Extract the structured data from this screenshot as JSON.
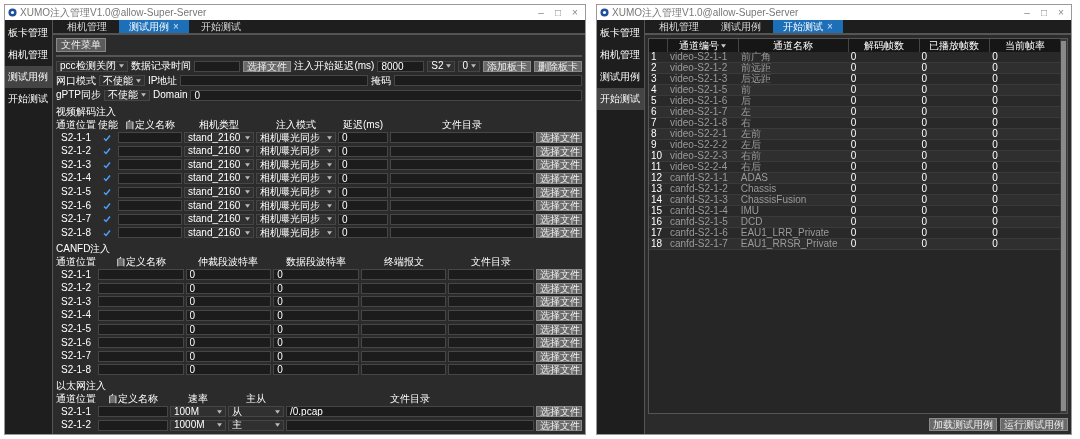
{
  "windows": [
    {
      "kind": "editor",
      "title": "XUMO注入管理V1.0@allow-Super-Server",
      "controls": [
        "–",
        "□",
        "×"
      ],
      "sidebar": [
        {
          "label": "板卡管理",
          "selected": false
        },
        {
          "label": "相机管理",
          "selected": false
        },
        {
          "label": "测试用例",
          "selected": true
        },
        {
          "label": "开始测试",
          "selected": false
        }
      ],
      "tabs": [
        {
          "label": "相机管理",
          "selected": false
        },
        {
          "label": "测试用例",
          "selected": true
        },
        {
          "label": "开始测试",
          "selected": false
        }
      ],
      "tab_close": "×",
      "toolbar_button": "文件菜单",
      "settings": [
        [
          {
            "kind": "select",
            "value": "pcc检测关闭"
          },
          {
            "kind": "label",
            "text": "数据记录时间"
          },
          {
            "kind": "input"
          },
          {
            "kind": "button",
            "label": "选择文件"
          },
          {
            "kind": "label",
            "text": "注入开始延迟(ms)"
          },
          {
            "kind": "input",
            "value": "8000"
          },
          {
            "kind": "select",
            "value": "S2"
          },
          {
            "kind": "select",
            "value": "0"
          },
          {
            "kind": "button",
            "label": "添加板卡"
          },
          {
            "kind": "button",
            "label": "删除板卡"
          }
        ],
        [
          {
            "kind": "label",
            "text": "网口模式"
          },
          {
            "kind": "select",
            "value": "不使能"
          },
          {
            "kind": "label",
            "text": "IP地址"
          },
          {
            "kind": "input"
          },
          {
            "kind": "label",
            "text": "掩码"
          },
          {
            "kind": "input"
          }
        ],
        [
          {
            "kind": "label",
            "text": "gPTP同步"
          },
          {
            "kind": "select",
            "value": "不使能"
          },
          {
            "kind": "label",
            "text": "Domain"
          },
          {
            "kind": "input",
            "value": "0"
          }
        ]
      ],
      "sections": [
        {
          "kind": "video",
          "title": "视频解码注入",
          "columns": [
            "通道位置",
            "使能",
            "自定义名称",
            "相机类型",
            "注入模式",
            "延迟(ms)",
            "文件目录"
          ],
          "rows": [
            [
              {
                "kind": "text",
                "text": "S2-1-1"
              },
              {
                "kind": "check",
                "checked": true
              },
              {
                "kind": "input"
              },
              {
                "kind": "select",
                "value": "stand_2160"
              },
              {
                "kind": "select",
                "value": "相机曝光同步"
              },
              {
                "kind": "input",
                "value": "0"
              },
              {
                "kind": "input"
              },
              {
                "kind": "button",
                "label": "选择文件"
              }
            ],
            [
              {
                "kind": "text",
                "text": "S2-1-2"
              },
              {
                "kind": "check",
                "checked": true
              },
              {
                "kind": "input"
              },
              {
                "kind": "select",
                "value": "stand_2160"
              },
              {
                "kind": "select",
                "value": "相机曝光同步"
              },
              {
                "kind": "input",
                "value": "0"
              },
              {
                "kind": "input"
              },
              {
                "kind": "button",
                "label": "选择文件"
              }
            ],
            [
              {
                "kind": "text",
                "text": "S2-1-3"
              },
              {
                "kind": "check",
                "checked": true
              },
              {
                "kind": "input"
              },
              {
                "kind": "select",
                "value": "stand_2160"
              },
              {
                "kind": "select",
                "value": "相机曝光同步"
              },
              {
                "kind": "input",
                "value": "0"
              },
              {
                "kind": "input"
              },
              {
                "kind": "button",
                "label": "选择文件"
              }
            ],
            [
              {
                "kind": "text",
                "text": "S2-1-4"
              },
              {
                "kind": "check",
                "checked": true
              },
              {
                "kind": "input"
              },
              {
                "kind": "select",
                "value": "stand_2160"
              },
              {
                "kind": "select",
                "value": "相机曝光同步"
              },
              {
                "kind": "input",
                "value": "0"
              },
              {
                "kind": "input"
              },
              {
                "kind": "button",
                "label": "选择文件"
              }
            ],
            [
              {
                "kind": "text",
                "text": "S2-1-5"
              },
              {
                "kind": "check",
                "checked": true
              },
              {
                "kind": "input"
              },
              {
                "kind": "select",
                "value": "stand_2160"
              },
              {
                "kind": "select",
                "value": "相机曝光同步"
              },
              {
                "kind": "input",
                "value": "0"
              },
              {
                "kind": "input"
              },
              {
                "kind": "button",
                "label": "选择文件"
              }
            ],
            [
              {
                "kind": "text",
                "text": "S2-1-6"
              },
              {
                "kind": "check",
                "checked": true
              },
              {
                "kind": "input"
              },
              {
                "kind": "select",
                "value": "stand_2160"
              },
              {
                "kind": "select",
                "value": "相机曝光同步"
              },
              {
                "kind": "input",
                "value": "0"
              },
              {
                "kind": "input"
              },
              {
                "kind": "button",
                "label": "选择文件"
              }
            ],
            [
              {
                "kind": "text",
                "text": "S2-1-7"
              },
              {
                "kind": "check",
                "checked": true
              },
              {
                "kind": "input"
              },
              {
                "kind": "select",
                "value": "stand_2160"
              },
              {
                "kind": "select",
                "value": "相机曝光同步"
              },
              {
                "kind": "input",
                "value": "0"
              },
              {
                "kind": "input"
              },
              {
                "kind": "button",
                "label": "选择文件"
              }
            ],
            [
              {
                "kind": "text",
                "text": "S2-1-8"
              },
              {
                "kind": "check",
                "checked": true
              },
              {
                "kind": "input"
              },
              {
                "kind": "select",
                "value": "stand_2160"
              },
              {
                "kind": "select",
                "value": "相机曝光同步"
              },
              {
                "kind": "input",
                "value": "0"
              },
              {
                "kind": "input"
              },
              {
                "kind": "button",
                "label": "选择文件"
              }
            ]
          ]
        },
        {
          "kind": "canfd",
          "title": "CANFD注入",
          "columns": [
            "通道位置",
            "自定义名称",
            "仲裁段波特率",
            "数据段波特率",
            "终端报文",
            "文件目录"
          ],
          "rows": [
            [
              {
                "kind": "text",
                "text": "S2-1-1"
              },
              {
                "kind": "input"
              },
              {
                "kind": "input",
                "value": "0"
              },
              {
                "kind": "input",
                "value": "0"
              },
              {
                "kind": "input"
              },
              {
                "kind": "input"
              },
              {
                "kind": "button",
                "label": "选择文件"
              }
            ],
            [
              {
                "kind": "text",
                "text": "S2-1-2"
              },
              {
                "kind": "input"
              },
              {
                "kind": "input",
                "value": "0"
              },
              {
                "kind": "input",
                "value": "0"
              },
              {
                "kind": "input"
              },
              {
                "kind": "input"
              },
              {
                "kind": "button",
                "label": "选择文件"
              }
            ],
            [
              {
                "kind": "text",
                "text": "S2-1-3"
              },
              {
                "kind": "input"
              },
              {
                "kind": "input",
                "value": "0"
              },
              {
                "kind": "input",
                "value": "0"
              },
              {
                "kind": "input"
              },
              {
                "kind": "input"
              },
              {
                "kind": "button",
                "label": "选择文件"
              }
            ],
            [
              {
                "kind": "text",
                "text": "S2-1-4"
              },
              {
                "kind": "input"
              },
              {
                "kind": "input",
                "value": "0"
              },
              {
                "kind": "input",
                "value": "0"
              },
              {
                "kind": "input"
              },
              {
                "kind": "input"
              },
              {
                "kind": "button",
                "label": "选择文件"
              }
            ],
            [
              {
                "kind": "text",
                "text": "S2-1-5"
              },
              {
                "kind": "input"
              },
              {
                "kind": "input",
                "value": "0"
              },
              {
                "kind": "input",
                "value": "0"
              },
              {
                "kind": "input"
              },
              {
                "kind": "input"
              },
              {
                "kind": "button",
                "label": "选择文件"
              }
            ],
            [
              {
                "kind": "text",
                "text": "S2-1-6"
              },
              {
                "kind": "input"
              },
              {
                "kind": "input",
                "value": "0"
              },
              {
                "kind": "input",
                "value": "0"
              },
              {
                "kind": "input"
              },
              {
                "kind": "input"
              },
              {
                "kind": "button",
                "label": "选择文件"
              }
            ],
            [
              {
                "kind": "text",
                "text": "S2-1-7"
              },
              {
                "kind": "input"
              },
              {
                "kind": "input",
                "value": "0"
              },
              {
                "kind": "input",
                "value": "0"
              },
              {
                "kind": "input"
              },
              {
                "kind": "input"
              },
              {
                "kind": "button",
                "label": "选择文件"
              }
            ],
            [
              {
                "kind": "text",
                "text": "S2-1-8"
              },
              {
                "kind": "input"
              },
              {
                "kind": "input",
                "value": "0"
              },
              {
                "kind": "input",
                "value": "0"
              },
              {
                "kind": "input"
              },
              {
                "kind": "input"
              },
              {
                "kind": "button",
                "label": "选择文件"
              }
            ]
          ]
        },
        {
          "kind": "ethernet",
          "title": "以太网注入",
          "columns": [
            "通道位置",
            "自定义名称",
            "速率",
            "主从",
            "文件目录"
          ],
          "rows": [
            [
              {
                "kind": "text",
                "text": "S2-1-1"
              },
              {
                "kind": "input"
              },
              {
                "kind": "select",
                "value": "100M"
              },
              {
                "kind": "select",
                "value": "从"
              },
              {
                "kind": "input",
                "value": "/0.pcap"
              },
              {
                "kind": "button",
                "label": "选择文件"
              }
            ],
            [
              {
                "kind": "text",
                "text": "S2-1-2"
              },
              {
                "kind": "input"
              },
              {
                "kind": "select",
                "value": "1000M"
              },
              {
                "kind": "select",
                "value": "主"
              },
              {
                "kind": "input"
              },
              {
                "kind": "button",
                "label": "选择文件"
              }
            ]
          ]
        }
      ]
    },
    {
      "kind": "runner",
      "title": "XUMO注入管理V1.0@allow-Super-Server",
      "controls": [
        "–",
        "□",
        "×"
      ],
      "sidebar": [
        {
          "label": "板卡管理",
          "selected": false
        },
        {
          "label": "相机管理",
          "selected": false
        },
        {
          "label": "测试用例",
          "selected": false
        },
        {
          "label": "开始测试",
          "selected": true
        }
      ],
      "tabs": [
        {
          "label": "相机管理",
          "selected": false
        },
        {
          "label": "测试用例",
          "selected": false
        },
        {
          "label": "开始测试",
          "selected": true
        }
      ],
      "tab_close": "×",
      "table": {
        "columns": [
          "通道编号",
          "通道名称",
          "解码帧数",
          "已播放帧数",
          "当前帧率"
        ],
        "rows": [
          {
            "number": "1",
            "cells": [
              "video-S2-1-1",
              "前广角",
              "0",
              "0",
              "0"
            ]
          },
          {
            "number": "2",
            "cells": [
              "video-S2-1-2",
              "前远距",
              "0",
              "0",
              "0"
            ]
          },
          {
            "number": "3",
            "cells": [
              "video-S2-1-3",
              "后远距",
              "0",
              "0",
              "0"
            ]
          },
          {
            "number": "4",
            "cells": [
              "video-S2-1-5",
              "前",
              "0",
              "0",
              "0"
            ]
          },
          {
            "number": "5",
            "cells": [
              "video-S2-1-6",
              "后",
              "0",
              "0",
              "0"
            ]
          },
          {
            "number": "6",
            "cells": [
              "video-S2-1-7",
              "左",
              "0",
              "0",
              "0"
            ]
          },
          {
            "number": "7",
            "cells": [
              "video-S2-1-8",
              "右",
              "0",
              "0",
              "0"
            ]
          },
          {
            "number": "8",
            "cells": [
              "video-S2-2-1",
              "左前",
              "0",
              "0",
              "0"
            ]
          },
          {
            "number": "9",
            "cells": [
              "video-S2-2-2",
              "左后",
              "0",
              "0",
              "0"
            ]
          },
          {
            "number": "10",
            "cells": [
              "video-S2-2-3",
              "右前",
              "0",
              "0",
              "0"
            ]
          },
          {
            "number": "11",
            "cells": [
              "video-S2-2-4",
              "右后",
              "0",
              "0",
              "0"
            ]
          },
          {
            "number": "12",
            "cells": [
              "canfd-S2-1-1",
              "ADAS",
              "0",
              "0",
              "0"
            ]
          },
          {
            "number": "13",
            "cells": [
              "canfd-S2-1-2",
              "Chassis",
              "0",
              "0",
              "0"
            ]
          },
          {
            "number": "14",
            "cells": [
              "canfd-S2-1-3",
              "ChassisFusion",
              "0",
              "0",
              "0"
            ]
          },
          {
            "number": "15",
            "cells": [
              "canfd-S2-1-4",
              "IMU",
              "0",
              "0",
              "0"
            ]
          },
          {
            "number": "16",
            "cells": [
              "canfd-S2-1-5",
              "DCD",
              "0",
              "0",
              "0"
            ]
          },
          {
            "number": "17",
            "cells": [
              "canfd-S2-1-6",
              "EAU1_LRR_Private",
              "0",
              "0",
              "0"
            ]
          },
          {
            "number": "18",
            "cells": [
              "canfd-S2-1-7",
              "EAU1_RRSR_Private",
              "0",
              "0",
              "0"
            ]
          }
        ]
      },
      "buttons": [
        "加载测试用例",
        "运行测试用例"
      ]
    }
  ]
}
